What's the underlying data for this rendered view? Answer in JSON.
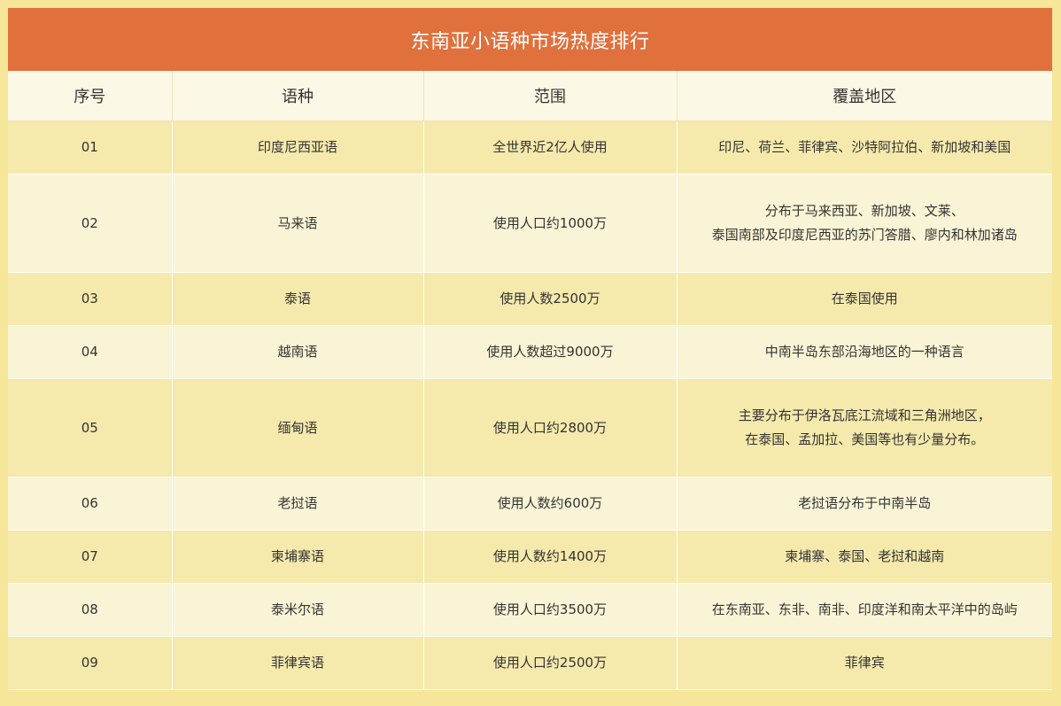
{
  "title": "东南亚小语种市场热度排行",
  "headers": {
    "index": "序号",
    "language": "语种",
    "range": "范围",
    "region": "覆盖地区"
  },
  "rows": [
    {
      "index": "01",
      "language": "印度尼西亚语",
      "range": "全世界近2亿人使用",
      "region": [
        "印尼、荷兰、菲律宾、沙特阿拉伯、新加坡和美国"
      ]
    },
    {
      "index": "02",
      "language": "马来语",
      "range": "使用人口约1000万",
      "region": [
        "分布于马来西亚、新加坡、文莱、",
        "泰国南部及印度尼西亚的苏门答腊、廖内和林加诸岛"
      ]
    },
    {
      "index": "03",
      "language": "泰语",
      "range": "使用人数2500万",
      "region": [
        "在泰国使用"
      ]
    },
    {
      "index": "04",
      "language": "越南语",
      "range": "使用人数超过9000万",
      "region": [
        "中南半岛东部沿海地区的一种语言"
      ]
    },
    {
      "index": "05",
      "language": "缅甸语",
      "range": "使用人口约2800万",
      "region": [
        "主要分布于伊洛瓦底江流域和三角洲地区，",
        "在泰国、孟加拉、美国等也有少量分布。"
      ]
    },
    {
      "index": "06",
      "language": "老挝语",
      "range": "使用人数约600万",
      "region": [
        "老挝语分布于中南半岛"
      ]
    },
    {
      "index": "07",
      "language": "柬埔寨语",
      "range": "使用人数约1400万",
      "region": [
        "柬埔寨、泰国、老挝和越南"
      ]
    },
    {
      "index": "08",
      "language": "泰米尔语",
      "range": "使用人口约3500万",
      "region": [
        "在东南亚、东非、南非、印度洋和南太平洋中的岛屿"
      ]
    },
    {
      "index": "09",
      "language": "菲律宾语",
      "range": "使用人口约2500万",
      "region": [
        "菲律宾"
      ]
    }
  ]
}
